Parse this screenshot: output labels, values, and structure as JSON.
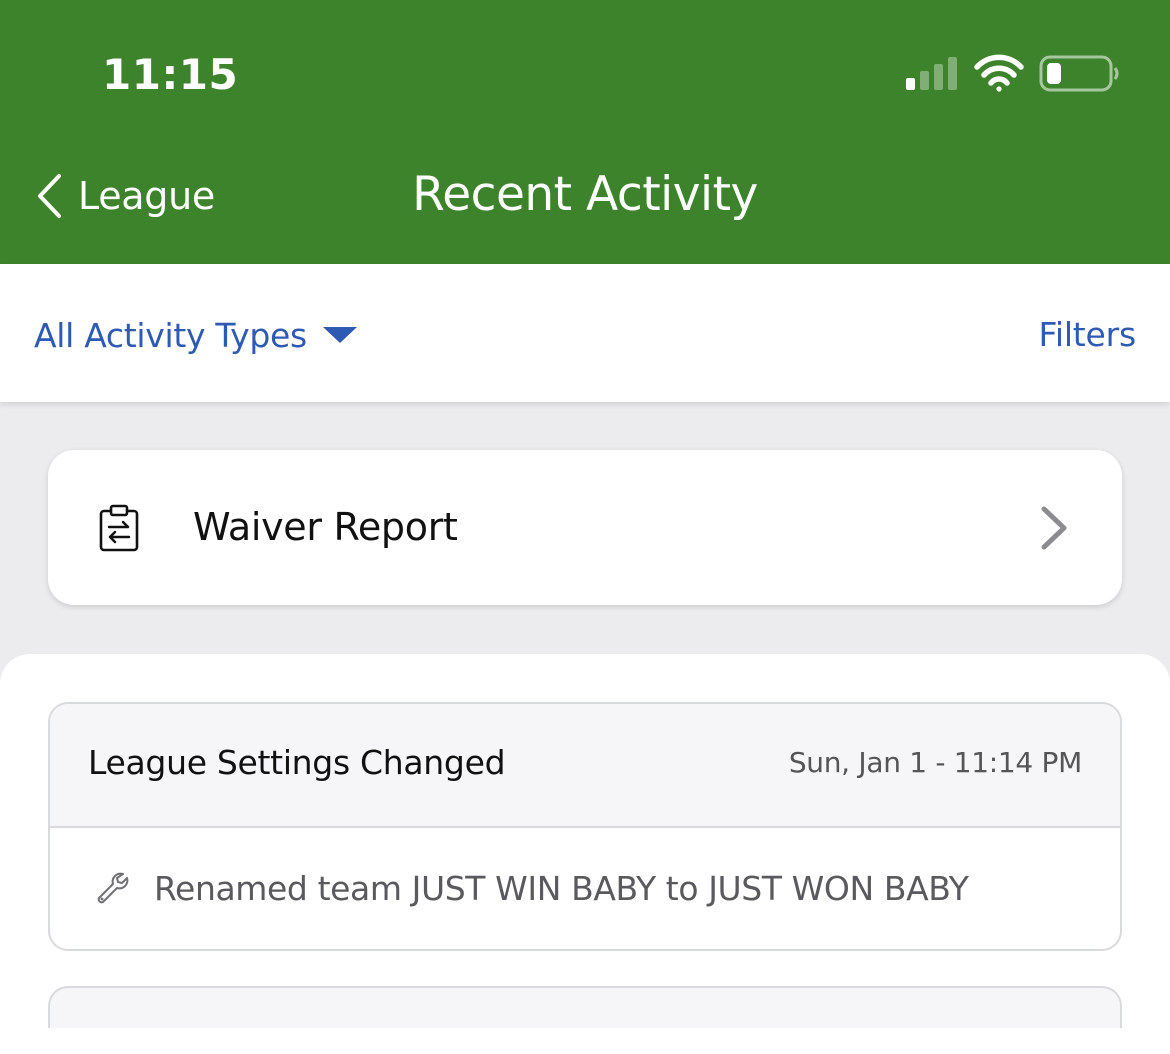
{
  "status_bar": {
    "time": "11:15"
  },
  "nav": {
    "back_label": "League",
    "title": "Recent Activity"
  },
  "filter_bar": {
    "activity_type_label": "All Activity Types",
    "filters_label": "Filters"
  },
  "waiver_report": {
    "label": "Waiver Report"
  },
  "activities": [
    {
      "title": "League Settings Changed",
      "timestamp": "Sun, Jan 1 - 11:14 PM",
      "detail": "Renamed team JUST WIN BABY to JUST WON BABY"
    }
  ],
  "colors": {
    "header_green": "#3d832b",
    "link_blue": "#2f5ab3",
    "page_gray": "#ececee"
  },
  "icons": {
    "back": "chevron-left-icon",
    "dropdown": "caret-down-icon",
    "waiver": "clipboard-transfer-icon",
    "disclosure": "chevron-right-icon",
    "settings_change": "wrench-icon"
  }
}
